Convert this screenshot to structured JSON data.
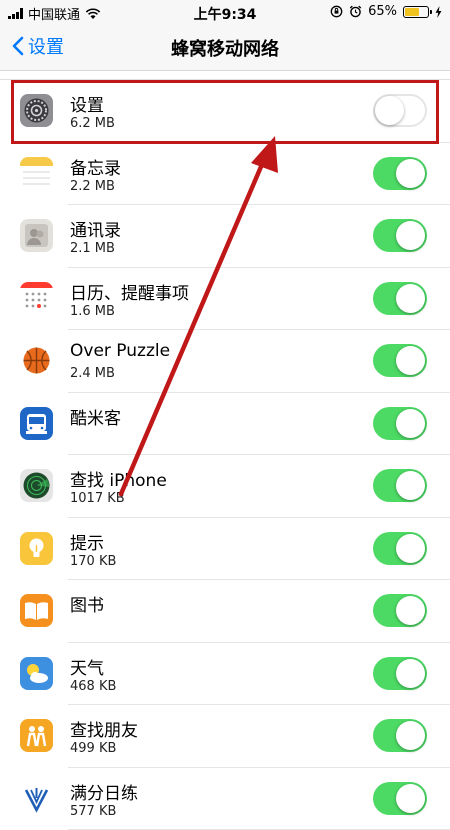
{
  "status_bar": {
    "carrier": "中国联通",
    "time": "上午9:34",
    "battery": "65%"
  },
  "nav": {
    "back_label": "设置",
    "title": "蜂窝移动网络"
  },
  "apps": [
    {
      "name": "设置",
      "size": "6.2 MB",
      "enabled": false,
      "icon": "settings-icon"
    },
    {
      "name": "备忘录",
      "size": "2.2 MB",
      "enabled": true,
      "icon": "notes-icon"
    },
    {
      "name": "通讯录",
      "size": "2.1 MB",
      "enabled": true,
      "icon": "contacts-icon"
    },
    {
      "name": "日历、提醒事项",
      "size": "1.6 MB",
      "enabled": true,
      "icon": "calendar-icon"
    },
    {
      "name": "Over Puzzle",
      "size": "2.4 MB",
      "enabled": true,
      "icon": "basketball-icon"
    },
    {
      "name": "酷米客",
      "size": "",
      "enabled": true,
      "icon": "bus-icon"
    },
    {
      "name": "查找 iPhone",
      "size": "1017 KB",
      "enabled": true,
      "icon": "radar-icon"
    },
    {
      "name": "提示",
      "size": "170 KB",
      "enabled": true,
      "icon": "lightbulb-icon"
    },
    {
      "name": "图书",
      "size": "",
      "enabled": true,
      "icon": "book-icon"
    },
    {
      "name": "天气",
      "size": "468 KB",
      "enabled": true,
      "icon": "weather-icon"
    },
    {
      "name": "查找朋友",
      "size": "499 KB",
      "enabled": true,
      "icon": "friends-icon"
    },
    {
      "name": "满分日练",
      "size": "577 KB",
      "enabled": true,
      "icon": "sport-logo-icon"
    }
  ],
  "colors": {
    "accent": "#007aff",
    "toggle_on": "#4cd964",
    "annotation_red": "#c01818"
  }
}
